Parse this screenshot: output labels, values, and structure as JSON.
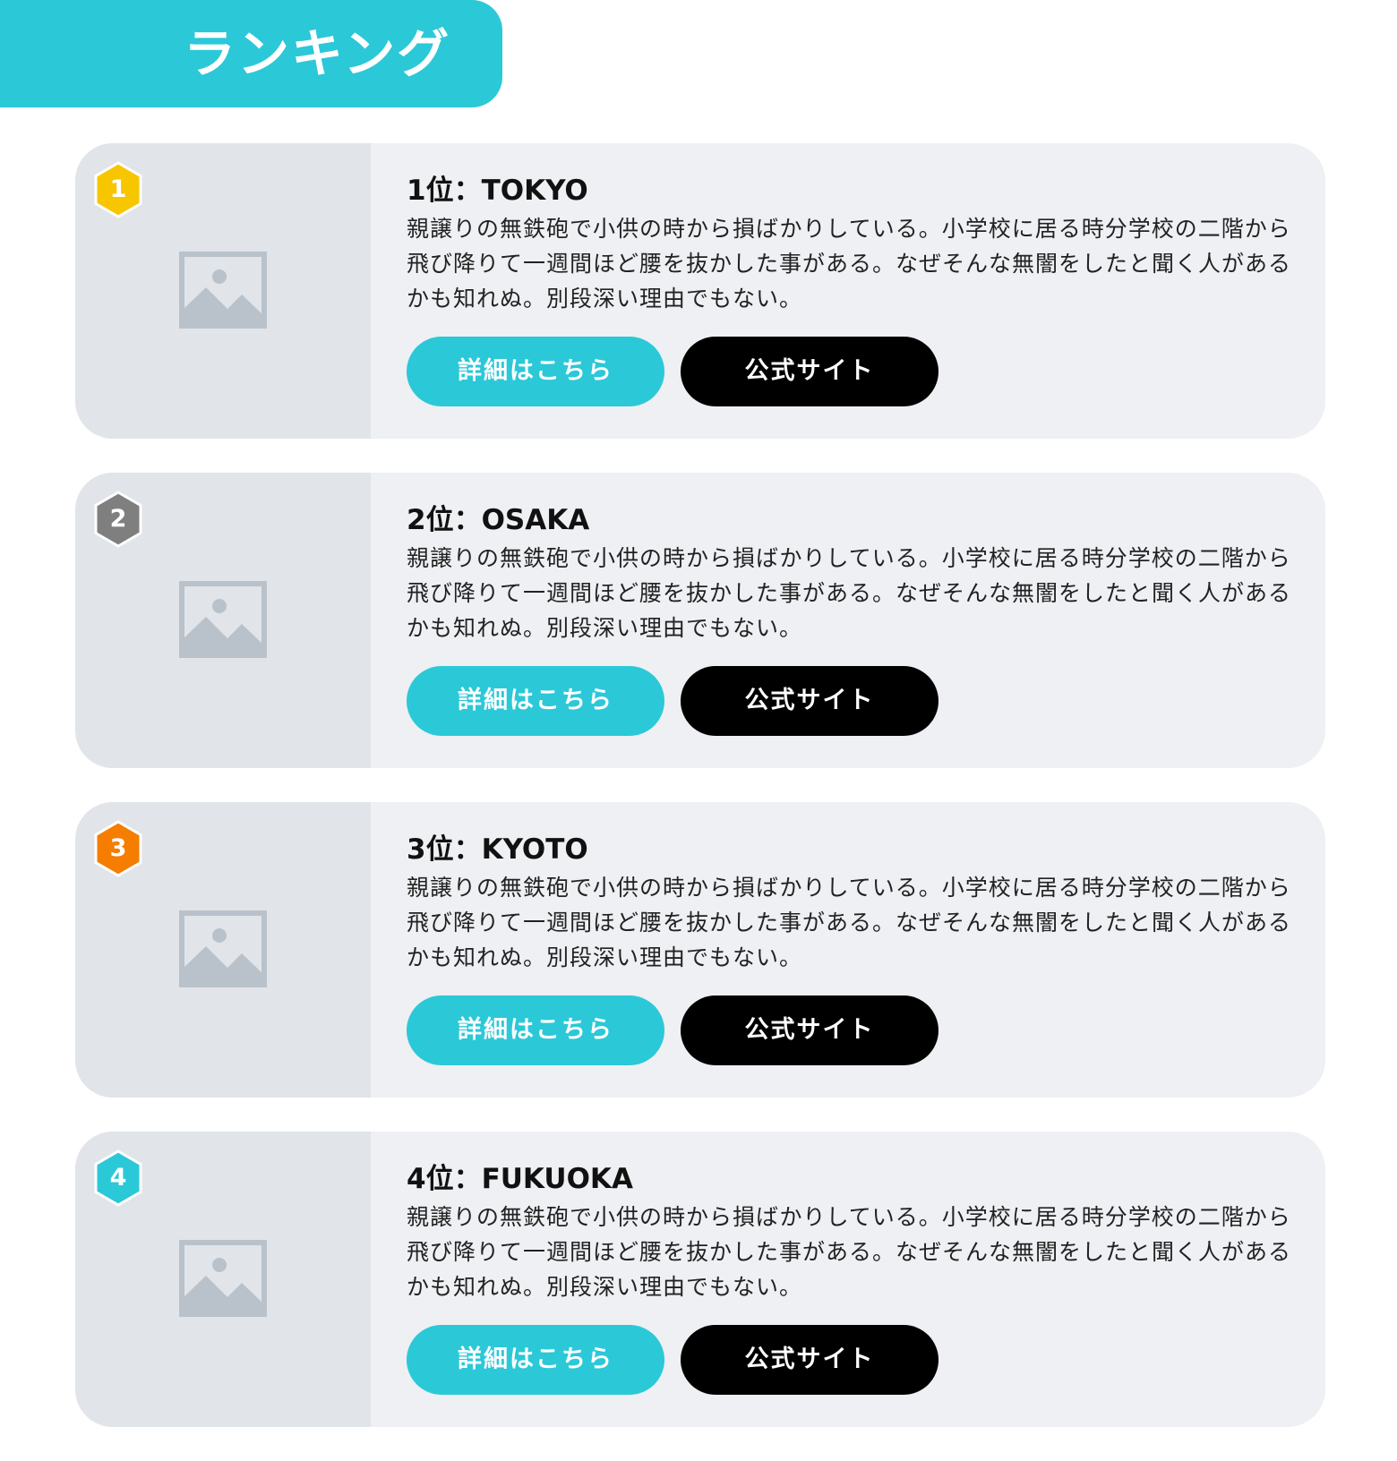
{
  "header": {
    "title": "ランキング",
    "color": "#2bc8d8"
  },
  "ranking": [
    {
      "rank": "1",
      "badge_color": "#f7c600",
      "title": "1位：TOKYO",
      "description": "親譲りの無鉄砲で小供の時から損ばかりしている。小学校に居る時分学校の二階から飛び降りて一週間ほど腰を抜かした事がある。なぜそんな無闇をしたと聞く人があるかも知れぬ。別段深い理由でもない。",
      "image_icon": "image-placeholder-icon",
      "detail_label": "詳細はこちら",
      "official_label": "公式サイト"
    },
    {
      "rank": "2",
      "badge_color": "#7f7f7f",
      "title": "2位：OSAKA",
      "description": "親譲りの無鉄砲で小供の時から損ばかりしている。小学校に居る時分学校の二階から飛び降りて一週間ほど腰を抜かした事がある。なぜそんな無闇をしたと聞く人があるかも知れぬ。別段深い理由でもない。",
      "image_icon": "image-placeholder-icon",
      "detail_label": "詳細はこちら",
      "official_label": "公式サイト"
    },
    {
      "rank": "3",
      "badge_color": "#f57d00",
      "title": "3位：KYOTO",
      "description": "親譲りの無鉄砲で小供の時から損ばかりしている。小学校に居る時分学校の二階から飛び降りて一週間ほど腰を抜かした事がある。なぜそんな無闇をしたと聞く人があるかも知れぬ。別段深い理由でもない。",
      "image_icon": "image-placeholder-icon",
      "detail_label": "詳細はこちら",
      "official_label": "公式サイト"
    },
    {
      "rank": "4",
      "badge_color": "#2bc8d8",
      "title": "4位：FUKUOKA",
      "description": "親譲りの無鉄砲で小供の時から損ばかりしている。小学校に居る時分学校の二階から飛び降りて一週間ほど腰を抜かした事がある。なぜそんな無闇をしたと聞く人があるかも知れぬ。別段深い理由でもない。",
      "image_icon": "image-placeholder-icon",
      "detail_label": "詳細はこちら",
      "official_label": "公式サイト"
    }
  ],
  "colors": {
    "accent": "#2bc8d8",
    "card_bg": "#eef0f3",
    "image_bg": "#e1e4e8",
    "placeholder": "#b9c2cb",
    "official_button": "#000000"
  }
}
